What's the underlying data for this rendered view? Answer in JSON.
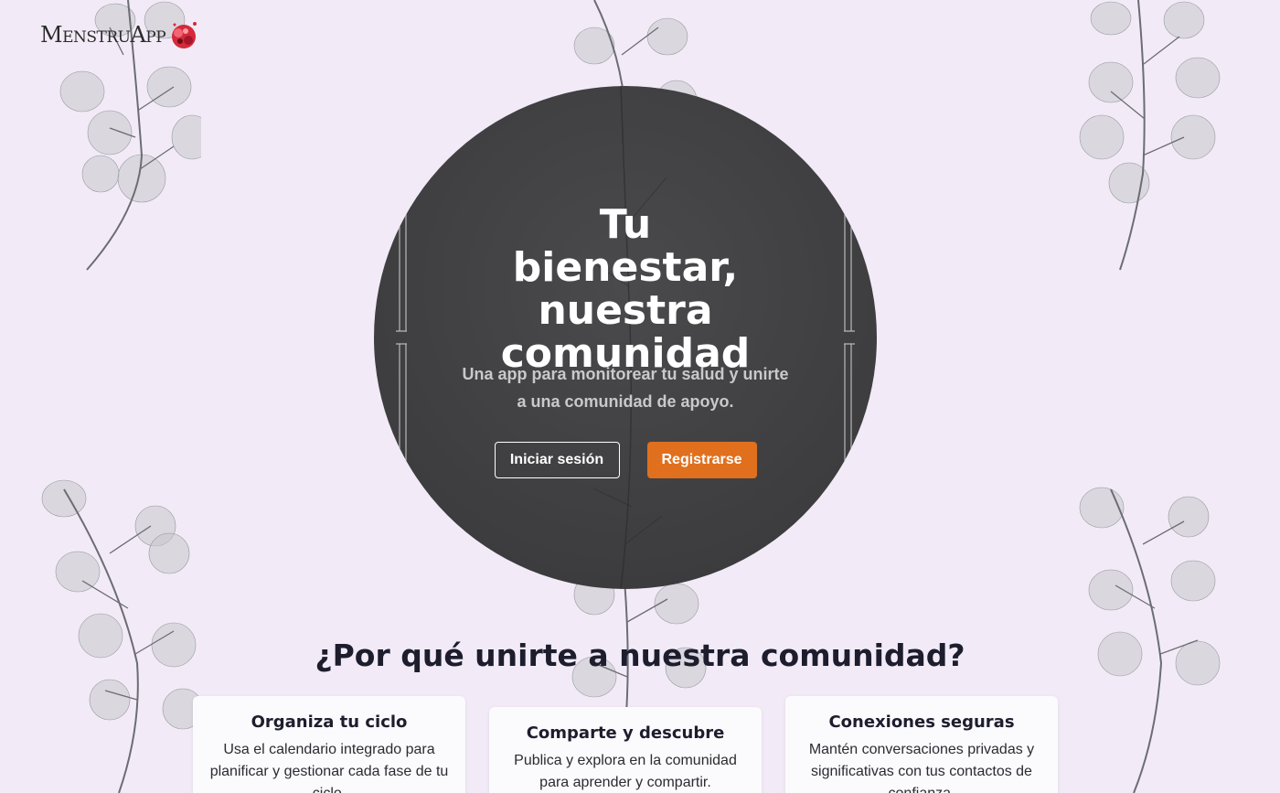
{
  "brand": {
    "logo_text": "MenstruApp",
    "icon": "flower-icon"
  },
  "hero": {
    "title": "Tu bienestar, nuestra comunidad",
    "subtitle": "Una app para monitorear tu salud y unirte a una comunidad de apoyo.",
    "login_label": "Iniciar sesión",
    "register_label": "Registrarse"
  },
  "why": {
    "title": "¿Por qué unirte a nuestra comunidad?",
    "cards": [
      {
        "title": "Organiza tu ciclo",
        "text": "Usa el calendario integrado para planificar y gestionar cada fase de tu ciclo."
      },
      {
        "title": "Comparte y descubre",
        "text": "Publica y explora en la comunidad para aprender y compartir."
      },
      {
        "title": "Conexiones seguras",
        "text": "Mantén conversaciones privadas y significativas con tus contactos de confianza."
      }
    ]
  },
  "colors": {
    "background": "#f2ebf7",
    "hero": "#414143",
    "accent": "#e0701e",
    "text": "#1d1d2e"
  }
}
